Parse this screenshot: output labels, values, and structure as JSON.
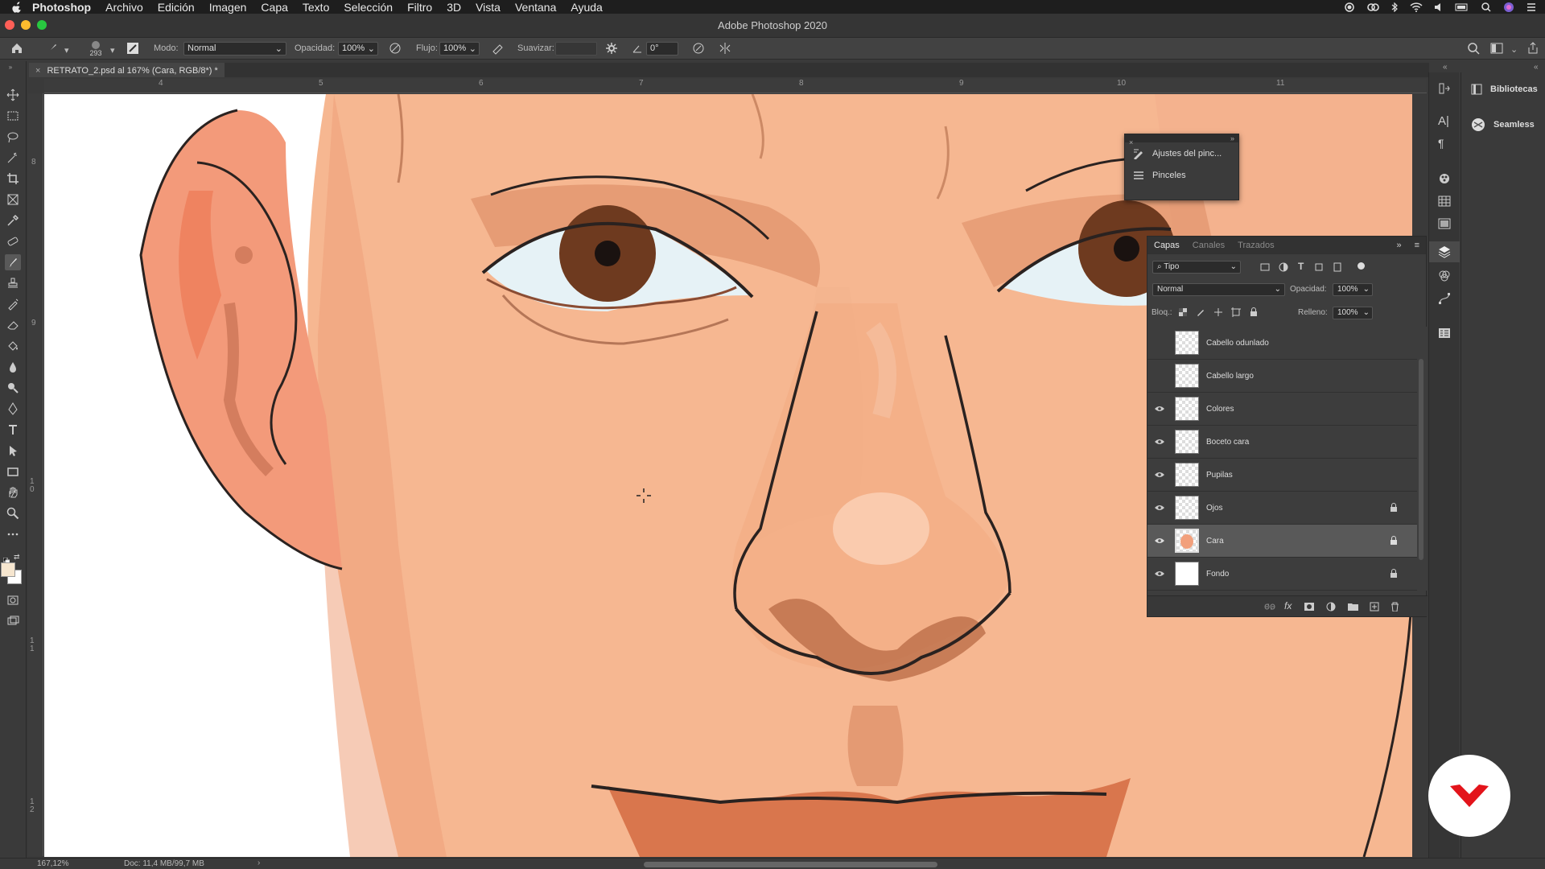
{
  "menubar": {
    "app": "Photoshop",
    "items": [
      "Archivo",
      "Edición",
      "Imagen",
      "Capa",
      "Texto",
      "Selección",
      "Filtro",
      "3D",
      "Vista",
      "Ventana",
      "Ayuda"
    ]
  },
  "window": {
    "title": "Adobe Photoshop 2020"
  },
  "options": {
    "brush_size": "293",
    "mode_label": "Modo:",
    "mode_value": "Normal",
    "opacity_label": "Opacidad:",
    "opacity_value": "100%",
    "flow_label": "Flujo:",
    "flow_value": "100%",
    "smoothing_label": "Suavizar:",
    "smoothing_value": "",
    "angle_value": "0°"
  },
  "document": {
    "tab_title": "RETRATO_2.psd al 167% (Cara, RGB/8*) *",
    "ruler_h": [
      "4",
      "5",
      "6",
      "7",
      "8",
      "9",
      "10",
      "11"
    ],
    "ruler_v": [
      "8",
      "9",
      "1 0",
      "1 1",
      "1 2"
    ]
  },
  "brush_panel": {
    "items": [
      "Ajustes del pinc...",
      "Pinceles"
    ]
  },
  "layers_panel": {
    "tabs": [
      "Capas",
      "Canales",
      "Trazados"
    ],
    "filter_value": "Tipo",
    "blend_mode": "Normal",
    "opacity_label": "Opacidad:",
    "opacity_value": "100%",
    "lock_label": "Bloq.:",
    "fill_label": "Relleno:",
    "fill_value": "100%",
    "layers": [
      {
        "name": "Cabello odunlado",
        "visible": false,
        "locked": false,
        "selected": false
      },
      {
        "name": "Cabello largo",
        "visible": false,
        "locked": false,
        "selected": false
      },
      {
        "name": "Colores",
        "visible": true,
        "locked": false,
        "selected": false
      },
      {
        "name": "Boceto cara",
        "visible": true,
        "locked": false,
        "selected": false
      },
      {
        "name": "Pupilas",
        "visible": true,
        "locked": false,
        "selected": false
      },
      {
        "name": "Ojos",
        "visible": true,
        "locked": true,
        "selected": false
      },
      {
        "name": "Cara",
        "visible": true,
        "locked": true,
        "selected": true
      },
      {
        "name": "Fondo",
        "visible": true,
        "locked": true,
        "selected": false
      }
    ]
  },
  "right_panel": {
    "items": [
      "Bibliotecas",
      "Seamless"
    ]
  },
  "status": {
    "zoom": "167,12%",
    "doc_size": "Doc: 11,4 MB/99,7 MB"
  },
  "colors": {
    "skin": "#f6b791",
    "skin_shadow": "#e8946a",
    "outline": "#2a2220",
    "iris": "#6e3a1f",
    "lip": "#d9764d",
    "ear": "#f39a7a",
    "brand_red": "#e3141b"
  }
}
